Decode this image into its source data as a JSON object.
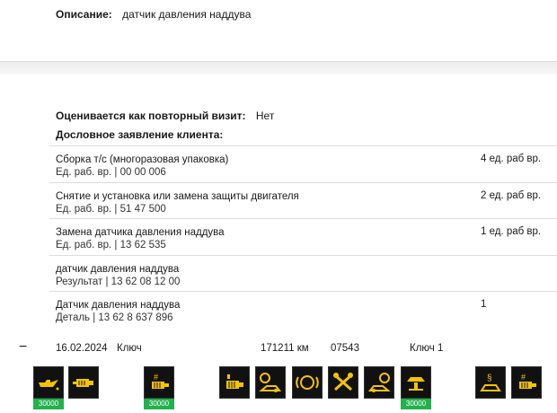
{
  "description": {
    "label": "Описание:",
    "value": "датчик давления наддува"
  },
  "repeat_visit": {
    "label": "Оценивается как повторный визит:",
    "value": "Нет"
  },
  "statement_label": "Дословное заявление клиента:",
  "items": [
    {
      "title": "Сборка т/с (многоразовая упаковка)",
      "code": "Ед. раб. вр. | 00 00 006",
      "amount": "4 ед. раб вр."
    },
    {
      "title": "Снятие и установка или замена защиты двигателя",
      "code": "Ед. раб. вр. | 51 47 500",
      "amount": "2 ед. раб вр."
    },
    {
      "title": "Замена датчика давления наддува",
      "code": "Ед. раб. вр. | 13 62 535",
      "amount": "1 ед. раб вр."
    },
    {
      "title": "датчик давления наддува",
      "code": "Результат | 13 62 08 12 00",
      "amount": ""
    },
    {
      "title": "Датчик давления наддува",
      "code": "Деталь | 13 62 8 637 896",
      "amount": "1"
    }
  ],
  "visit": {
    "collapse": "−",
    "date": "16.02.2024",
    "key_label": "Ключ",
    "km": "171211 км",
    "code": "07543",
    "key": "Ключ 1"
  },
  "tiles": [
    {
      "icon": "oil-can-icon",
      "label": "30000",
      "color": "#f5c400"
    },
    {
      "icon": "engine-filter-icon",
      "label": "",
      "color": "#f5c400"
    },
    {
      "icon": "hash-filter-icon",
      "label": "30000",
      "color": "#f5c400"
    },
    {
      "icon": "fuel-filter-icon",
      "label": "",
      "color": "#f5c400"
    },
    {
      "icon": "front-brakes-icon",
      "label": "",
      "color": "#f5c400"
    },
    {
      "icon": "brake-warning-icon",
      "label": "",
      "color": "#f5c400"
    },
    {
      "icon": "tools-icon",
      "label": "",
      "color": "#f5c400"
    },
    {
      "icon": "rear-brakes-icon",
      "label": "",
      "color": "#f5c400"
    },
    {
      "icon": "vehicle-lift-icon",
      "label": "30000",
      "color": "#f5c400"
    },
    {
      "icon": "legal-inspection-icon",
      "label": "",
      "color": "#f5c400"
    },
    {
      "icon": "hash-filter-2-icon",
      "label": "",
      "color": "#f5c400"
    }
  ]
}
